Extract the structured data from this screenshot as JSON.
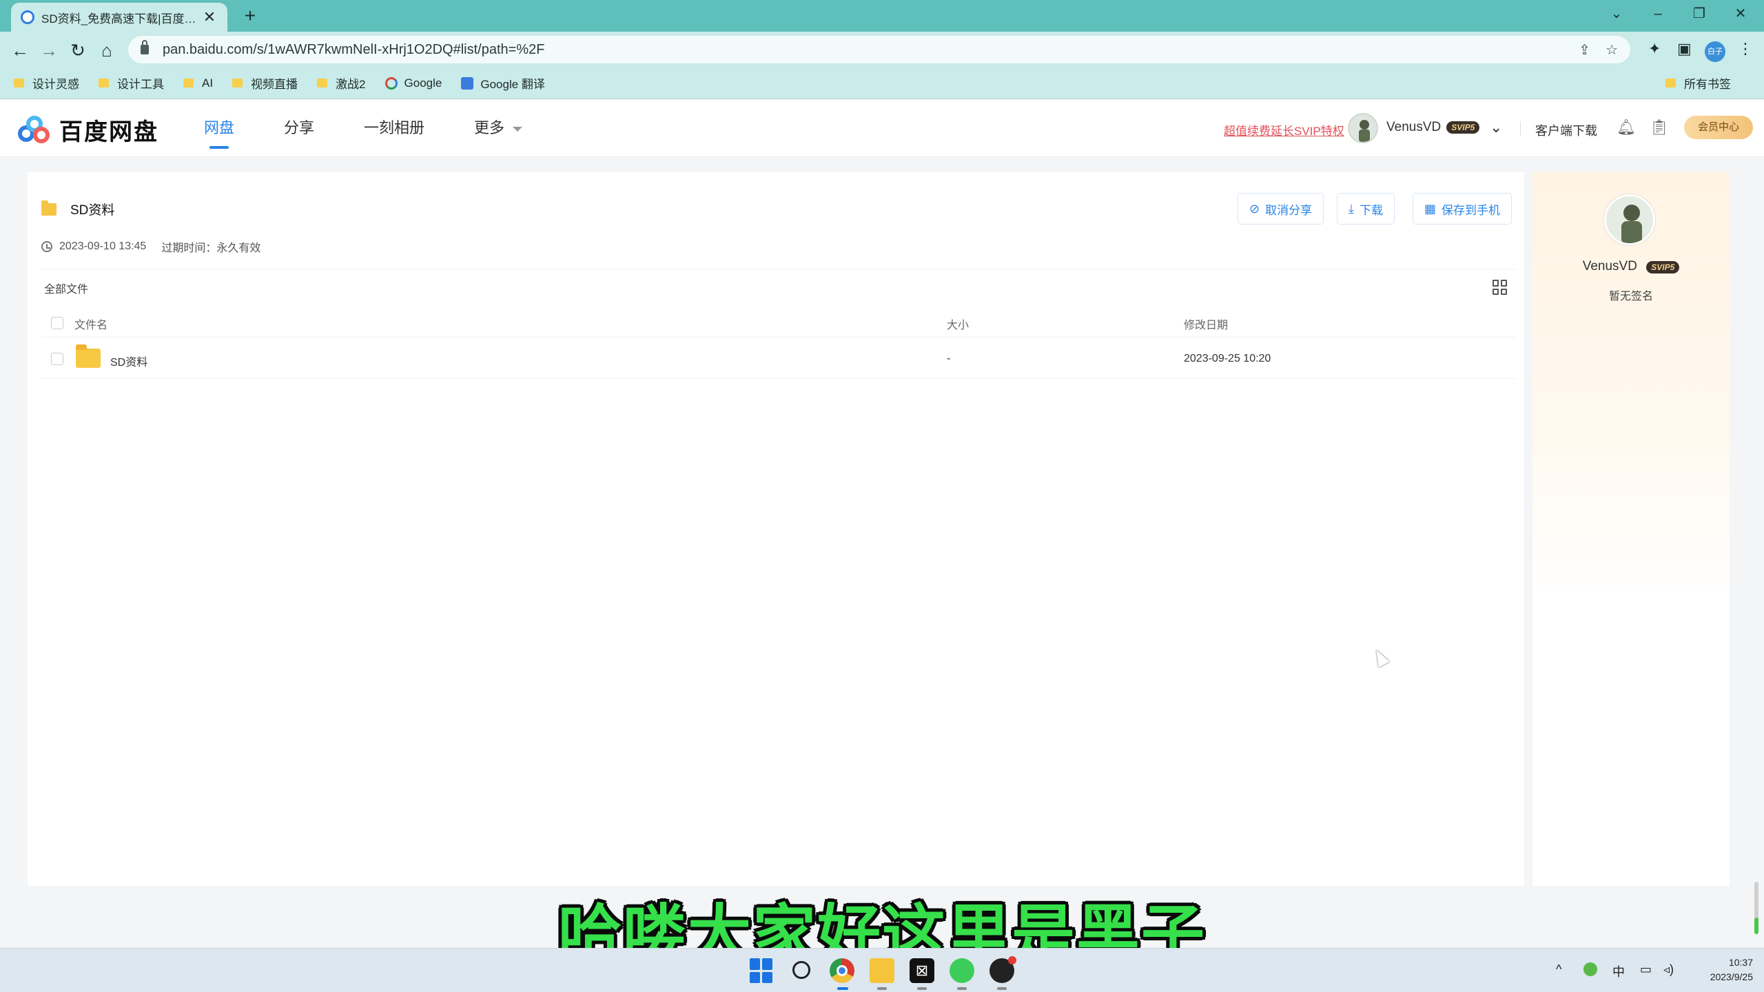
{
  "browser": {
    "tab_title": "SD资料_免费高速下载|百度网盘-",
    "tab_close": "✕",
    "new_tab": "+",
    "url": "pan.baidu.com/s/1wAWR7kwmNelI-xHrj1O2DQ#list/path=%2F",
    "profile_initials": "白子",
    "bookmarks": [
      {
        "label": "设计灵感",
        "icon": "folder-icon"
      },
      {
        "label": "设计工具",
        "icon": "folder-icon"
      },
      {
        "label": "AI",
        "icon": "folder-icon"
      },
      {
        "label": "视频直播",
        "icon": "folder-icon"
      },
      {
        "label": "激战2",
        "icon": "folder-icon"
      },
      {
        "label": "Google",
        "icon": "google-icon"
      },
      {
        "label": "Google 翻译",
        "icon": "google-translate-icon"
      }
    ],
    "all_bookmarks": "所有书签"
  },
  "header": {
    "logo_text": "百度网盘",
    "nav": [
      {
        "label": "网盘",
        "active": true
      },
      {
        "label": "分享",
        "active": false
      },
      {
        "label": "一刻相册",
        "active": false
      },
      {
        "label": "更多",
        "active": false
      }
    ],
    "promo": "超值续费延长SVIP特权",
    "username": "VenusVD",
    "badge": "SVIP5",
    "client_download": "客户端下载",
    "vip_center": "会员中心"
  },
  "share": {
    "title": "SD资料",
    "created": "2023-09-10 13:45",
    "expire": "过期时间：永久有效",
    "actions": {
      "cancel": "取消分享",
      "download": "下载",
      "save_phone": "保存到手机"
    },
    "all_files": "全部文件",
    "columns": {
      "name": "文件名",
      "size": "大小",
      "modified": "修改日期"
    },
    "rows": [
      {
        "name": "SD资料",
        "size": "-",
        "modified": "2023-09-25 10:20"
      }
    ]
  },
  "sidebar": {
    "username": "VenusVD",
    "badge": "SVIP5",
    "signature": "暂无签名"
  },
  "subtitle": "哈喽大家好这里是黑子",
  "taskbar": {
    "ime": "中",
    "time": "10:37",
    "date": "2023/9/25"
  },
  "colors": {
    "tab_strip": "#5fbfbb",
    "toolbar": "#c9ebe9",
    "accent": "#2a84e5",
    "promo": "#e0505a",
    "subtitle": "#35e04a"
  }
}
